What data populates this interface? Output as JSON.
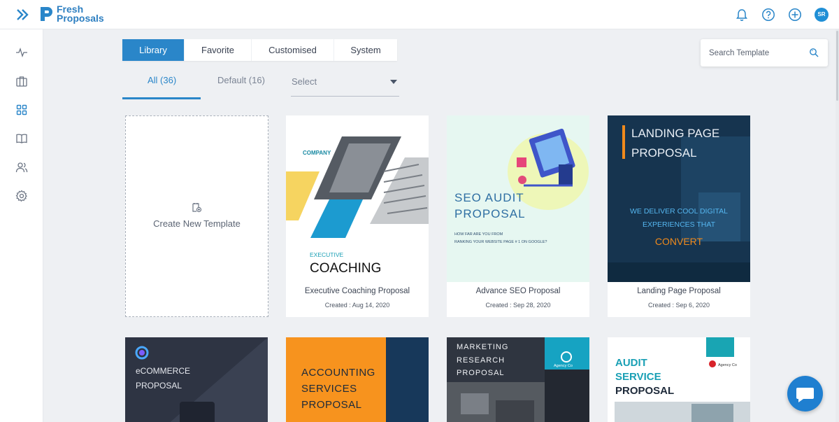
{
  "app": {
    "logo_line1": "Fresh",
    "logo_line2": "Proposals",
    "avatar_initials": "SR",
    "brand_color": "#2a86c9"
  },
  "topbar": {
    "icons": [
      "bell-icon",
      "help-icon",
      "add-icon"
    ]
  },
  "sidebar": {
    "icons": [
      "activity-icon",
      "briefcase-icon",
      "grid-icon",
      "book-icon",
      "users-icon",
      "settings-icon"
    ],
    "active": "grid-icon"
  },
  "tabs": [
    {
      "label": "Library",
      "active": true
    },
    {
      "label": "Favorite",
      "active": false
    },
    {
      "label": "Customised",
      "active": false
    },
    {
      "label": "System",
      "active": false
    }
  ],
  "filters": {
    "all_label": "All (36)",
    "default_label": "Default (16)",
    "select_placeholder": "Select"
  },
  "search": {
    "placeholder": "Search Template"
  },
  "create": {
    "label": "Create New Template"
  },
  "templates": [
    {
      "name": "Executive Coaching Proposal",
      "created": "Created : Aug 14, 2020",
      "thumb": {
        "company": "COMPANY",
        "kicker": "EXECUTIVE",
        "title": "COACHING"
      }
    },
    {
      "name": "Advance SEO Proposal",
      "created": "Created : Sep 28, 2020",
      "thumb": {
        "line1": "SEO AUDIT",
        "line2": "PROPOSAL",
        "sub1": "HOW FAR ARE YOU FROM",
        "sub2": "RANKING YOUR WEBSITE PAGE # 1 ON GOOGLE?"
      }
    },
    {
      "name": "Landing Page Proposal",
      "created": "Created : Sep 6, 2020",
      "thumb": {
        "line1": "LANDING PAGE",
        "line2": "PROPOSAL",
        "tag1": "WE DELIVER COOL DIGITAL",
        "tag2": "EXPERIENCES THAT",
        "tag3": "CONVERT"
      }
    }
  ],
  "templates_row2": [
    {
      "line1": "eCOMMERCE",
      "line2": "PROPOSAL"
    },
    {
      "line1": "ACCOUNTING",
      "line2": "SERVICES",
      "line3": "PROPOSAL"
    },
    {
      "line1": "MARKETING",
      "line2": "RESEARCH",
      "line3": "PROPOSAL",
      "badge": "Agency Co"
    },
    {
      "line1": "AUDIT",
      "line2": "SERVICE",
      "line3": "PROPOSAL",
      "brand": "Agency Co"
    }
  ]
}
